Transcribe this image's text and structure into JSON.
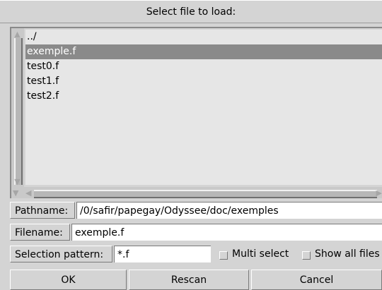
{
  "dialog": {
    "title": "Select file to load:"
  },
  "files": [
    "../",
    "exemple.f",
    "test0.f",
    "test1.f",
    "test2.f"
  ],
  "selected_file": "exemple.f",
  "pathname": {
    "label": "Pathname:",
    "value": "/0/safir/papegay/Odyssee/doc/exemples"
  },
  "filename": {
    "label": "Filename:",
    "value": "exemple.f"
  },
  "pattern": {
    "label": "Selection pattern:",
    "value": "*.f"
  },
  "options": {
    "multi_select": "Multi select",
    "show_all": "Show all files"
  },
  "buttons": {
    "ok": "OK",
    "rescan": "Rescan",
    "cancel": "Cancel"
  },
  "icons": {
    "scroll_up": "triangle-up-icon",
    "scroll_down": "triangle-down-icon",
    "scroll_left": "triangle-left-icon",
    "scroll_right": "triangle-right-icon"
  }
}
